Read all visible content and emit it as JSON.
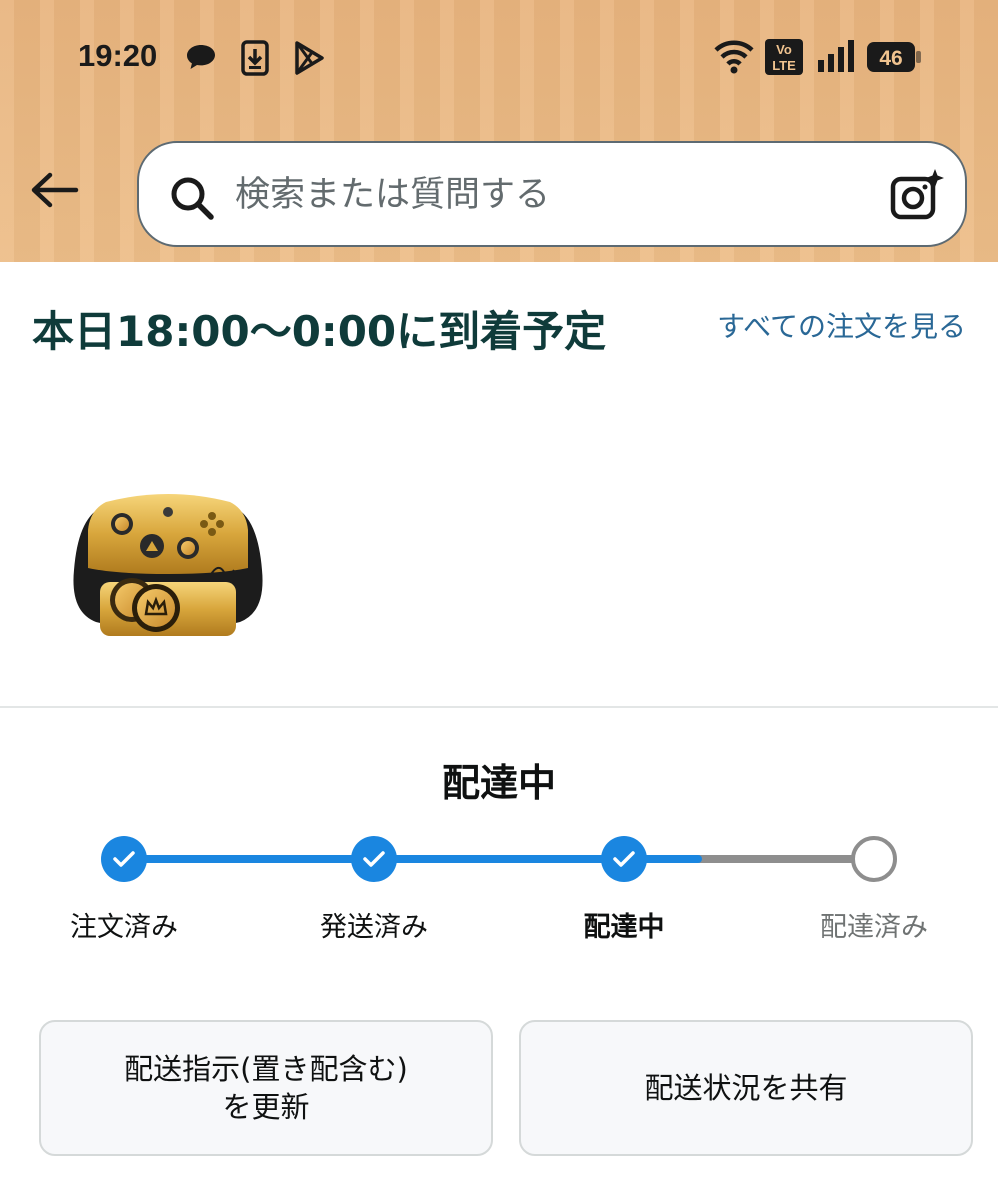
{
  "status_bar": {
    "time": "19:20",
    "left_icons": [
      "chat-bubble-icon",
      "download-icon",
      "play-store-icon"
    ],
    "volte_label": "Vo\nLTE",
    "battery": "46"
  },
  "header": {
    "search_placeholder": "検索または質問する",
    "icons": [
      "back-arrow-icon",
      "search-icon",
      "camera-sparkle-icon"
    ]
  },
  "order": {
    "arrival_text": "本日18:00～0:00に到着予定",
    "all_orders_link": "すべての注文を見る",
    "product_image": "gold-game-controller-on-stand"
  },
  "tracking": {
    "status_title": "配達中",
    "progress_fraction": 0.77,
    "steps": [
      {
        "label": "注文済み",
        "state": "done"
      },
      {
        "label": "発送済み",
        "state": "done"
      },
      {
        "label": "配達中",
        "state": "current"
      },
      {
        "label": "配達済み",
        "state": "pending"
      }
    ]
  },
  "actions": {
    "update_instructions": "配送指示(置き配含む)\nを更新",
    "share_status": "配送状況を共有"
  },
  "colors": {
    "header_bg": "#e8b47e",
    "accent_blue": "#1a86e0",
    "link_blue": "#2a6896",
    "pending_gray": "#8e8e8e"
  }
}
